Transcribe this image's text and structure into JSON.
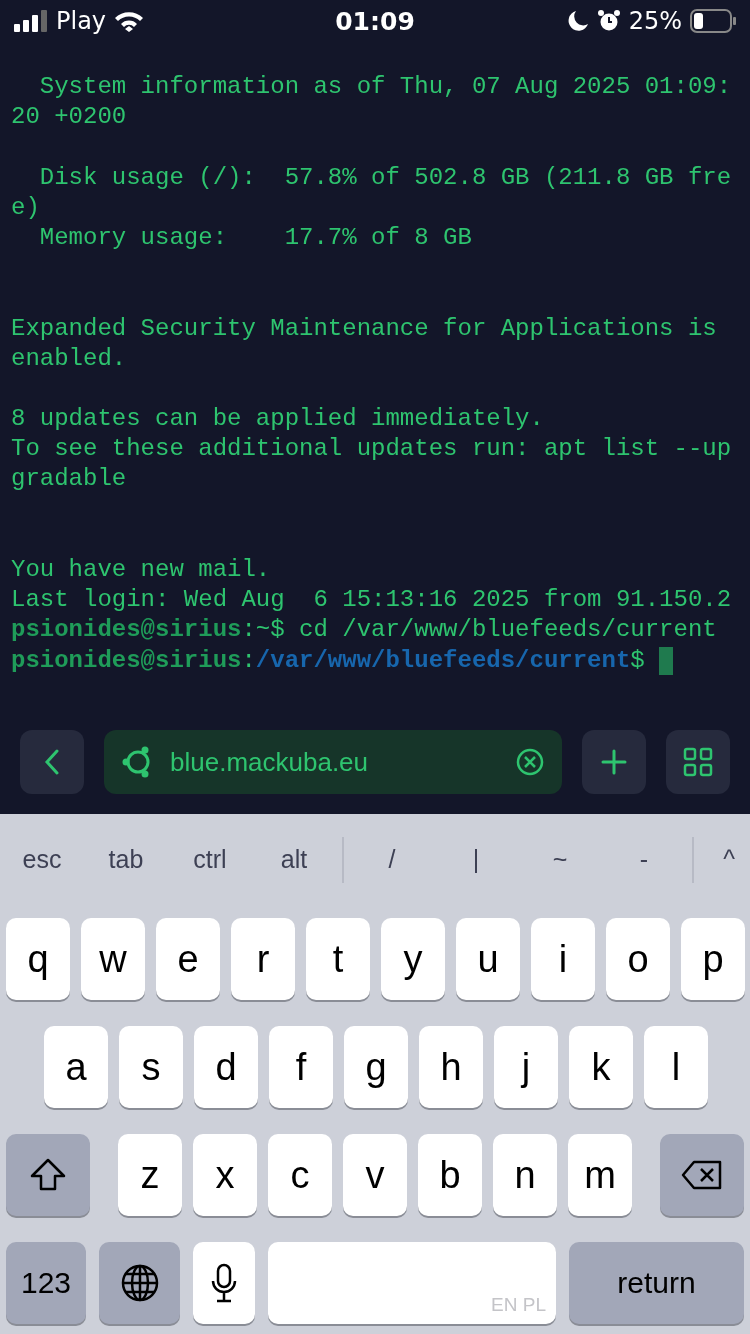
{
  "status_bar": {
    "carrier": "Play",
    "time": "01:09",
    "battery": "25%"
  },
  "terminal": {
    "lines": [
      {
        "kind": "output",
        "text": "  System information as of Thu, 07 Aug 2025 01:09:"
      },
      {
        "kind": "output",
        "text": "20 +0200"
      },
      {
        "kind": "blank"
      },
      {
        "kind": "output",
        "text": "  Disk usage (/):  57.8% of 502.8 GB (211.8 GB fre"
      },
      {
        "kind": "output",
        "text": "e)"
      },
      {
        "kind": "output",
        "text": "  Memory usage:    17.7% of 8 GB"
      },
      {
        "kind": "blank"
      },
      {
        "kind": "blank"
      },
      {
        "kind": "output",
        "text": "Expanded Security Maintenance for Applications is"
      },
      {
        "kind": "output",
        "text": "enabled."
      },
      {
        "kind": "blank"
      },
      {
        "kind": "output",
        "text": "8 updates can be applied immediately."
      },
      {
        "kind": "output",
        "text": "To see these additional updates run: apt list --up"
      },
      {
        "kind": "output",
        "text": "gradable"
      },
      {
        "kind": "blank"
      },
      {
        "kind": "blank"
      },
      {
        "kind": "output",
        "text": "You have new mail."
      },
      {
        "kind": "output",
        "text": "Last login: Wed Aug  6 15:13:16 2025 from 91.150.2"
      },
      {
        "kind": "prompt",
        "cursor": false,
        "parts": [
          {
            "kind": "user",
            "text": "psionides@sirius"
          },
          {
            "kind": "text",
            "text": ":~$ cd /var/www/bluefeeds/current"
          }
        ]
      },
      {
        "kind": "prompt",
        "cursor": true,
        "parts": [
          {
            "kind": "user",
            "text": "psionides@sirius"
          },
          {
            "kind": "text",
            "text": ":"
          },
          {
            "kind": "path",
            "text": "/var/www/bluefeeds/current"
          },
          {
            "kind": "text",
            "text": "$ "
          }
        ]
      }
    ]
  },
  "toolbar": {
    "host": "blue.mackuba.eu"
  },
  "keyboard": {
    "accessory_groups": [
      [
        "esc",
        "tab",
        "ctrl",
        "alt"
      ],
      [
        "/",
        "|",
        "~",
        "-"
      ],
      [
        "^"
      ]
    ],
    "letter_rows": [
      [
        "q",
        "w",
        "e",
        "r",
        "t",
        "y",
        "u",
        "i",
        "o",
        "p"
      ],
      [
        "a",
        "s",
        "d",
        "f",
        "g",
        "h",
        "j",
        "k",
        "l"
      ],
      [
        "z",
        "x",
        "c",
        "v",
        "b",
        "n",
        "m"
      ]
    ],
    "numbers_key": "123",
    "space_languages": "EN PL",
    "return_key": "return"
  }
}
